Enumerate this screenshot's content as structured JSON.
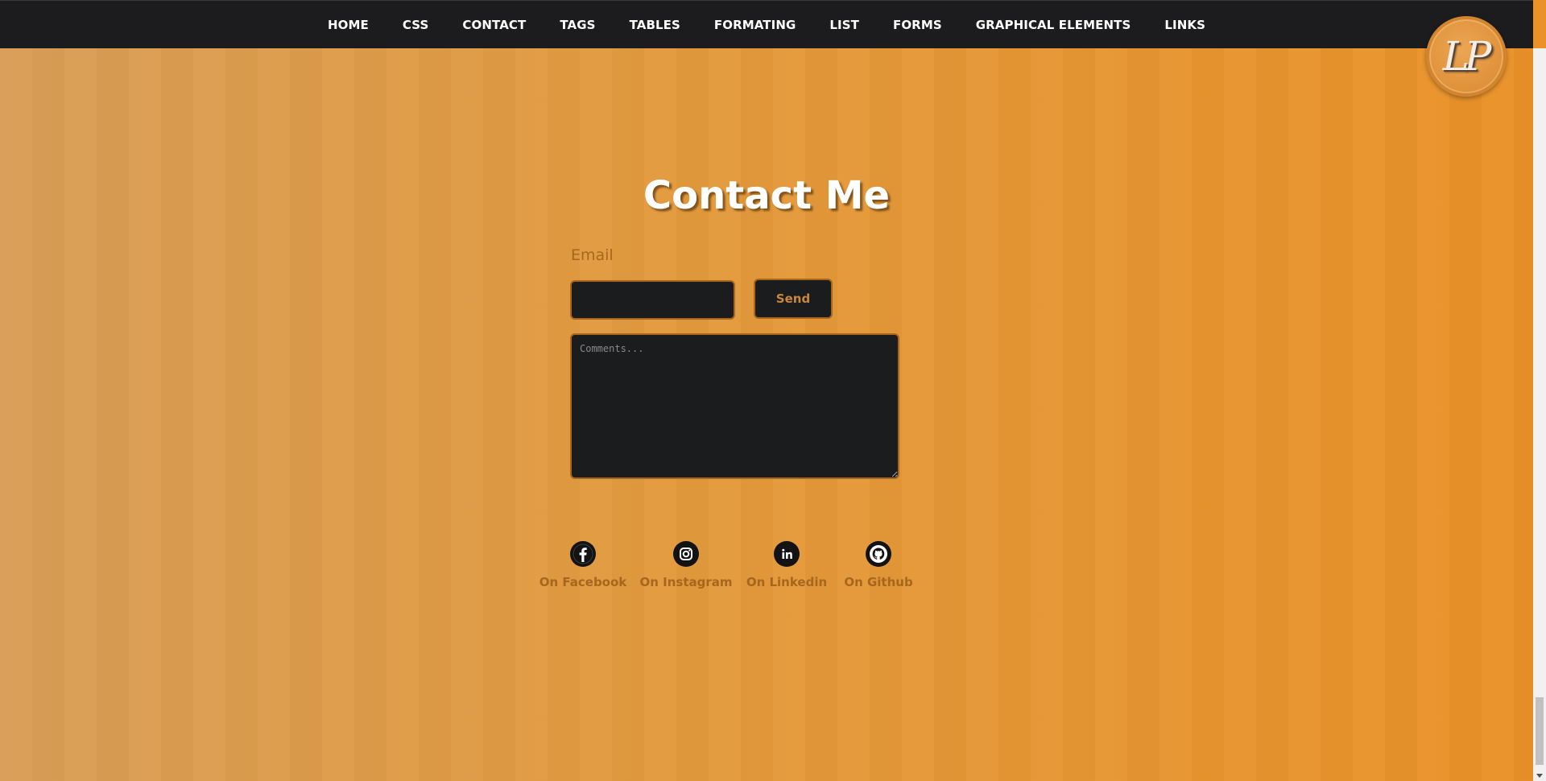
{
  "nav": {
    "items": [
      {
        "label": "HOME"
      },
      {
        "label": "CSS"
      },
      {
        "label": "CONTACT"
      },
      {
        "label": "TAGS"
      },
      {
        "label": "TABLES"
      },
      {
        "label": "FORMATING"
      },
      {
        "label": "LIST"
      },
      {
        "label": "FORMS"
      },
      {
        "label": "GRAPHICAL ELEMENTS"
      },
      {
        "label": "LINKS"
      }
    ]
  },
  "logo": {
    "text": "LP"
  },
  "contact": {
    "title": "Contact Me",
    "email_label": "Email",
    "email_value": "",
    "send_label": "Send",
    "comments_placeholder": "Comments...",
    "comments_value": ""
  },
  "socials": [
    {
      "label": "On Facebook",
      "icon": "facebook-icon"
    },
    {
      "label": "On Instagram",
      "icon": "instagram-icon"
    },
    {
      "label": "On Linkedin",
      "icon": "linkedin-icon"
    },
    {
      "label": "On Github",
      "icon": "github-icon"
    }
  ],
  "colors": {
    "nav_bg": "#1c1c1e",
    "accent": "#a8661c",
    "field_bg": "#1b1c1e",
    "bg_start": "#d99e57",
    "bg_end": "#ea9127"
  }
}
